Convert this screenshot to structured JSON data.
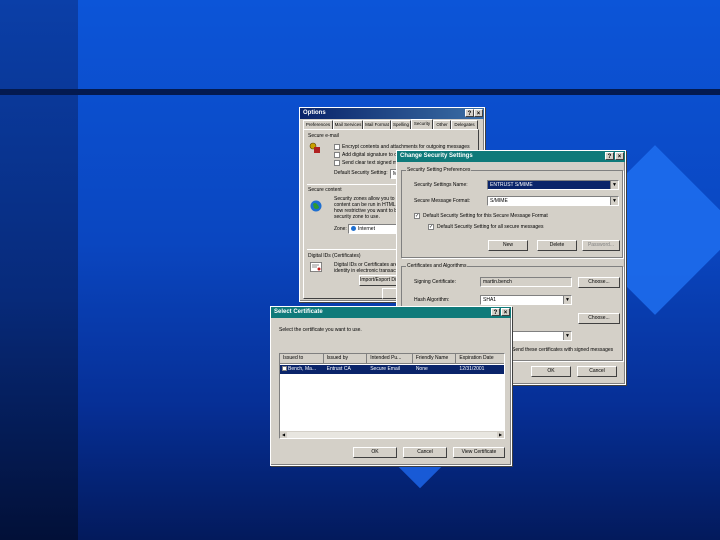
{
  "options": {
    "title": "Options",
    "tabs": [
      "Preferences",
      "Mail Services",
      "Mail Format",
      "Spelling",
      "Security",
      "Other",
      "Delegates"
    ],
    "active_tab": "Security",
    "secure_email_title": "Secure e-mail",
    "opt1": "Encrypt contents and attachments for outgoing messages",
    "opt2": "Add digital signature to outgoing",
    "opt3": "Send clear text signed message",
    "default_setting_label": "Default Security Setting:",
    "default_setting_value": "My S/MIME",
    "secure_content_title": "Secure content",
    "secure_content_text_1": "Security zones allow you to customize",
    "secure_content_text_2": "content can be run in HTML mes",
    "secure_content_text_3": "how restrictive you want to be",
    "secure_content_text_4": "security zone to use.",
    "zone_label": "Zone:",
    "zone_value": "Internet",
    "digital_ids_title": "Digital IDs (Certificates)",
    "digital_ids_text_1": "Digital IDs or Certificates are docu",
    "digital_ids_text_2": "identity in electronic transactions.",
    "import_export_label": "Import/Export Digital ID"
  },
  "change": {
    "title": "Change Security Settings",
    "help": "?",
    "close": "×",
    "prefs_title": "Security Setting Preferences",
    "name_label": "Security Settings Name:",
    "name_value": "ENTRUST S/MIME",
    "format_label": "Secure Message Format:",
    "format_value": "S/MIME",
    "default_for_format": "Default Security Setting for this Secure Message Format",
    "default_for_all": "Default Security Setting for all secure messages",
    "new_label": "New",
    "delete_label": "Delete",
    "password_label": "Password...",
    "cert_title": "Certificates and Algorithms",
    "signing_cert_label": "Signing Certificate:",
    "signing_cert_value": "martin.bench",
    "choose1": "Choose...",
    "hash_label": "Hash Algorithm:",
    "hash_value": "SHA1",
    "choose2": "Choose...",
    "send_certs_label": "Send these certificates with signed messages",
    "ok": "OK",
    "cancel": "Cancel"
  },
  "select": {
    "title": "Select Certificate",
    "help": "?",
    "close": "×",
    "instruction": "Select the certificate you want to use.",
    "columns": [
      "Issued to",
      "Issued by",
      "Intended Pu...",
      "Friendly Name",
      "Expiration Date"
    ],
    "rows": [
      [
        "Bench, Ma...",
        "Entrust CA",
        "Secure Email",
        "None",
        "12/31/2001"
      ]
    ],
    "ok": "OK",
    "cancel": "Cancel",
    "view": "View Certificate"
  },
  "colors": {
    "titlebar": "#0a246a",
    "teal_titlebar": "#0f7a7a",
    "window": "#d4d0c8",
    "selection": "#0a246a",
    "background": "#0a46c0"
  }
}
